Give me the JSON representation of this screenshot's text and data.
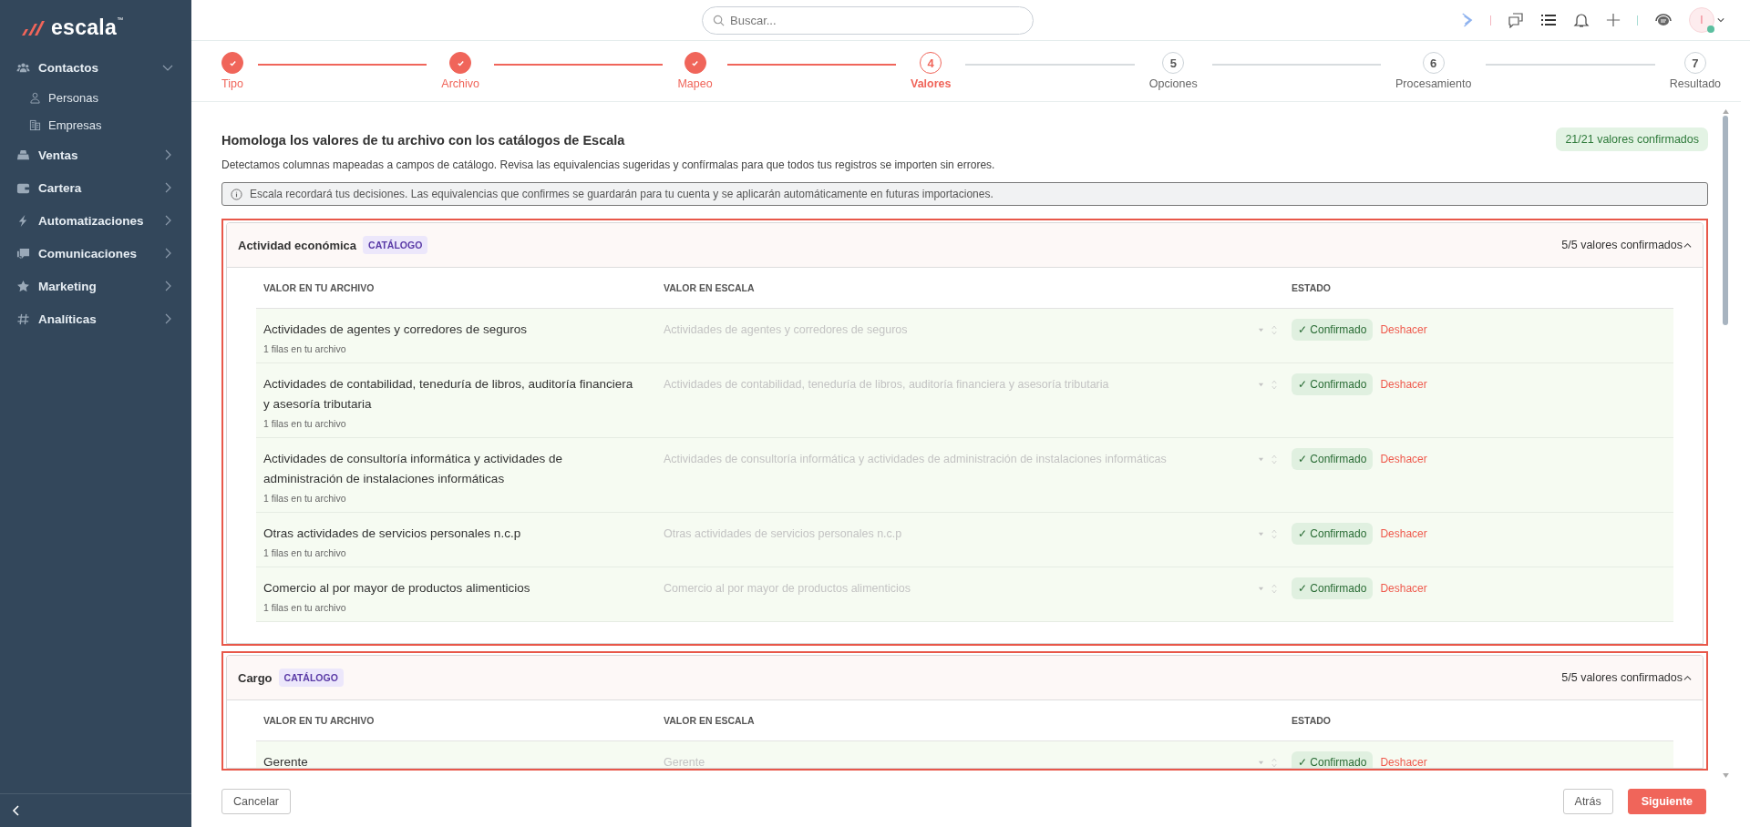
{
  "brand": {
    "name": "escala",
    "mark": "™"
  },
  "sidebar": {
    "items": [
      {
        "label": "Contactos",
        "expanded": true,
        "children": [
          {
            "label": "Personas"
          },
          {
            "label": "Empresas"
          }
        ]
      },
      {
        "label": "Ventas",
        "expanded": false
      },
      {
        "label": "Cartera",
        "expanded": false
      },
      {
        "label": "Automatizaciones",
        "expanded": false
      },
      {
        "label": "Comunicaciones",
        "expanded": false
      },
      {
        "label": "Marketing",
        "expanded": false
      },
      {
        "label": "Analíticas",
        "expanded": false
      }
    ]
  },
  "search": {
    "placeholder": "Buscar..."
  },
  "user": {
    "initial": "I",
    "online": true
  },
  "steps": [
    {
      "label": "Tipo",
      "done": true,
      "selected": false
    },
    {
      "label": "Archivo",
      "done": true,
      "selected": false
    },
    {
      "label": "Mapeo",
      "done": true,
      "selected": false
    },
    {
      "label": "Valores",
      "number": "4",
      "done": false,
      "selected": true
    },
    {
      "label": "Opciones",
      "number": "5",
      "done": false,
      "selected": false
    },
    {
      "label": "Procesamiento",
      "number": "6",
      "done": false,
      "selected": false
    },
    {
      "label": "Resultado",
      "number": "7",
      "done": false,
      "selected": false
    }
  ],
  "intro": {
    "title": "Homologa los valores de tu archivo con los catálogos de Escala",
    "description": "Detectamos columnas mapeadas a campos de catálogo. Revisa las equivalencias sugeridas y confírmalas para que todos tus registros se importen sin errores.",
    "badge": "21/21 valores confirmados",
    "notice": "Escala recordará tus decisiones. Las equivalencias que confirmes se guardarán para tu cuenta y se aplicarán automáticamente en futuras importaciones."
  },
  "sections": [
    {
      "title": "Actividad económica",
      "tag": "CATÁLOGO",
      "summary": "5/5 valores confirmados",
      "expanded": true,
      "columns": [
        "VALOR EN TU ARCHIVO",
        "VALOR EN ESCALA",
        "ESTADO"
      ],
      "rows": [
        {
          "value": "Actividades de agentes y corredores de seguros",
          "count": "1 filas en tu archivo",
          "mapped": "Actividades de agentes y corredores de seguros",
          "confirmed": true,
          "status": "✓ Confirmado",
          "undo": "Deshacer"
        },
        {
          "value": "Actividades de contabilidad, teneduría de libros, auditoría financiera y asesoría tributaria",
          "count": "1 filas en tu archivo",
          "mapped": "Actividades de contabilidad, teneduría de libros, auditoría financiera y asesoría tributaria",
          "confirmed": true,
          "status": "✓ Confirmado",
          "undo": "Deshacer"
        },
        {
          "value": "Actividades de consultoría informática y actividades de administración de instalaciones informáticas",
          "count": "1 filas en tu archivo",
          "mapped": "Actividades de consultoría informática y actividades de administración de instalaciones informáticas",
          "confirmed": true,
          "status": "✓ Confirmado",
          "undo": "Deshacer"
        },
        {
          "value": "Otras actividades de servicios personales n.c.p",
          "count": "1 filas en tu archivo",
          "mapped": "Otras actividades de servicios personales n.c.p",
          "confirmed": true,
          "status": "✓ Confirmado",
          "undo": "Deshacer"
        },
        {
          "value": "Comercio al por mayor de productos alimenticios",
          "count": "1 filas en tu archivo",
          "mapped": "Comercio al por mayor de productos alimenticios",
          "confirmed": true,
          "status": "✓ Confirmado",
          "undo": "Deshacer"
        }
      ]
    },
    {
      "title": "Cargo",
      "tag": "CATÁLOGO",
      "summary": "5/5 valores confirmados",
      "expanded": true,
      "columns": [
        "VALOR EN TU ARCHIVO",
        "VALOR EN ESCALA",
        "ESTADO"
      ],
      "rows": [
        {
          "value": "Gerente",
          "mapped": "Gerente",
          "confirmed": true,
          "status": "✓ Confirmado",
          "undo": "Deshacer"
        }
      ]
    }
  ],
  "footer": {
    "cancel": "Cancelar",
    "back": "Atrás",
    "next": "Siguiente"
  }
}
